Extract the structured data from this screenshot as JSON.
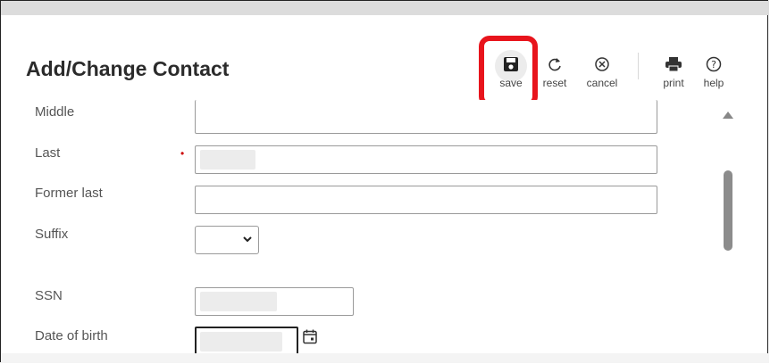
{
  "dialog": {
    "title": "Add/Change Contact"
  },
  "toolbar": {
    "save": {
      "icon": "floppy-disk-icon",
      "label": "save"
    },
    "reset": {
      "icon": "refresh-icon",
      "label": "reset"
    },
    "cancel": {
      "icon": "circle-x-icon",
      "label": "cancel"
    },
    "print": {
      "icon": "printer-icon",
      "label": "print"
    },
    "help": {
      "icon": "question-circle-icon",
      "label": "help"
    },
    "highlight_color": "#e8141c"
  },
  "form": {
    "middle_label": "Middle",
    "last_label": "Last",
    "last_required_marker": "•",
    "former_last_label": "Former last",
    "suffix_label": "Suffix",
    "suffix_value": "",
    "ssn_label": "SSN",
    "dob_label": "Date of birth"
  }
}
